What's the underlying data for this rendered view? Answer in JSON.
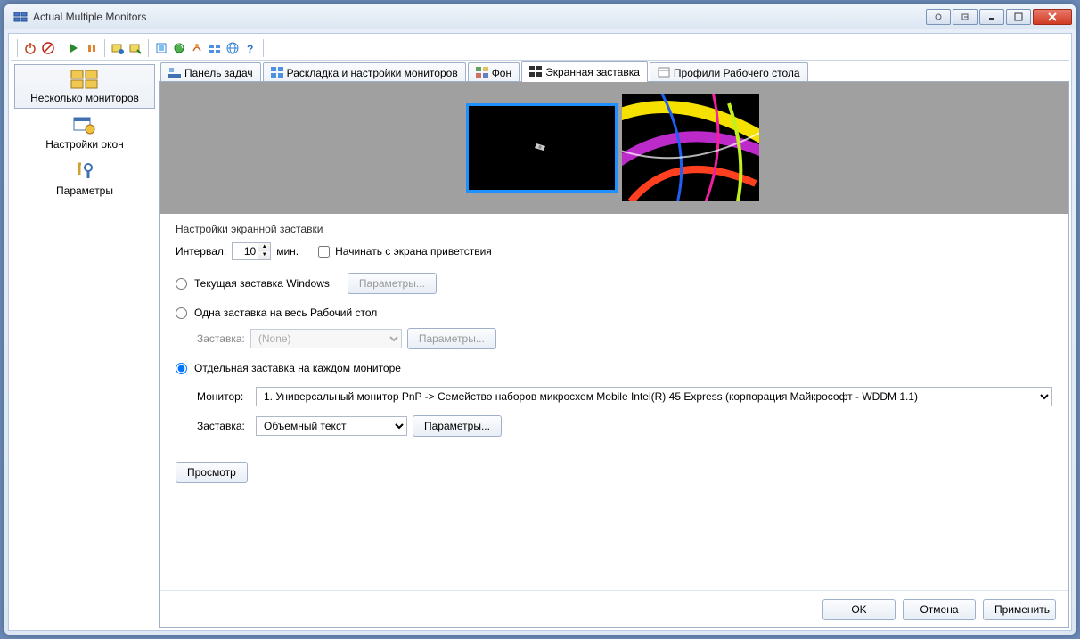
{
  "window": {
    "title": "Actual Multiple Monitors"
  },
  "nav": {
    "items": [
      {
        "label": "Несколько мониторов"
      },
      {
        "label": "Настройки окон"
      },
      {
        "label": "Параметры"
      }
    ]
  },
  "tabs": {
    "items": [
      {
        "label": "Панель задач"
      },
      {
        "label": "Раскладка и настройки мониторов"
      },
      {
        "label": "Фон"
      },
      {
        "label": "Экранная заставка"
      },
      {
        "label": "Профили Рабочего стола"
      }
    ]
  },
  "screensaver": {
    "group_label": "Настройки экранной заставки",
    "interval_label": "Интервал:",
    "interval_value": "10",
    "interval_unit": "мин.",
    "start_on_welcome": "Начинать с экрана приветствия",
    "radio_current": "Текущая заставка Windows",
    "radio_single": "Одна заставка на весь Рабочий стол",
    "radio_per_monitor": "Отдельная заставка на каждом мониторе",
    "label_screensaver": "Заставка:",
    "none_value": "(None)",
    "params_btn": "Параметры...",
    "monitor_label": "Монитор:",
    "monitor_value": "1. Универсальный монитор PnP -> Семейство наборов микросхем Mobile Intel(R) 45 Express (корпорация Майкрософт - WDDM 1.1)",
    "saver_value": "Объемный текст",
    "preview_btn": "Просмотр"
  },
  "buttons": {
    "ok": "OK",
    "cancel": "Отмена",
    "apply": "Применить"
  }
}
